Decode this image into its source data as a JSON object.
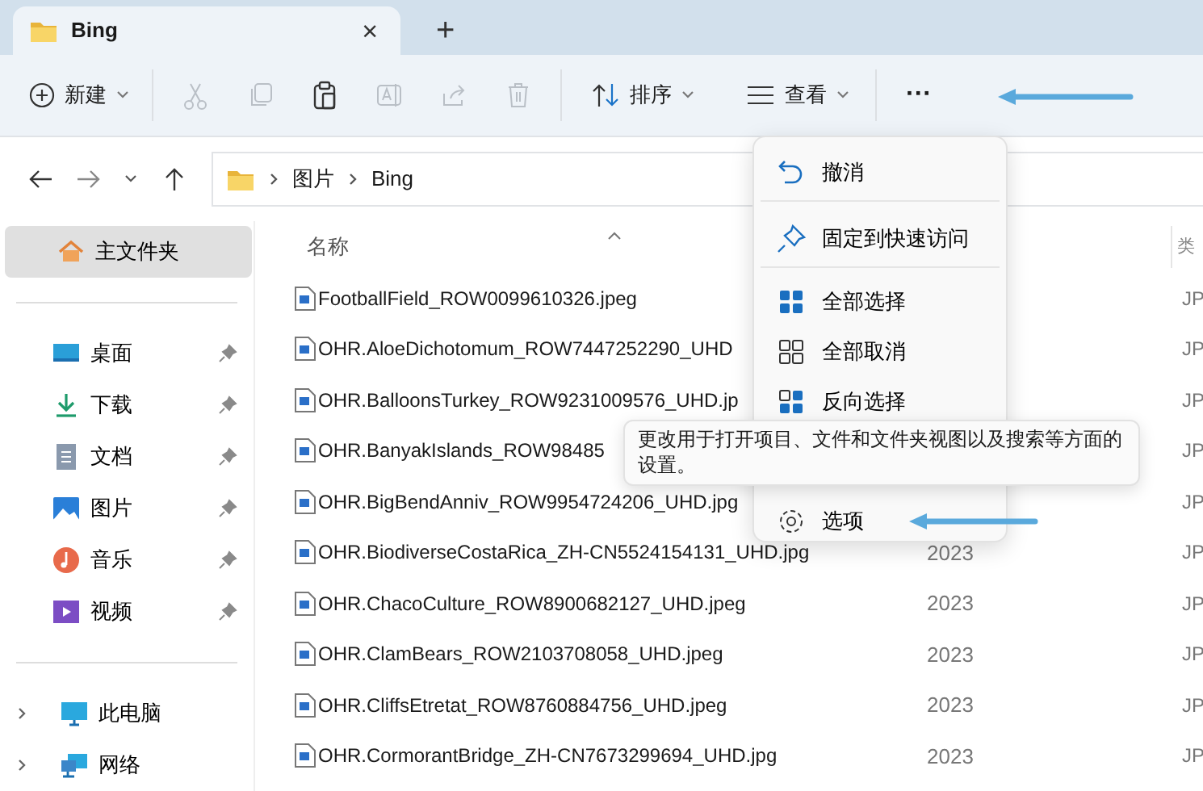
{
  "tab": {
    "title": "Bing",
    "close": "×"
  },
  "new_tab": "+",
  "toolbar": {
    "new": "新建",
    "actions": [
      {
        "kind": "cut",
        "disabled": true
      },
      {
        "kind": "copy",
        "disabled": true
      },
      {
        "kind": "paste",
        "disabled": false
      },
      {
        "kind": "rename",
        "disabled": true
      },
      {
        "kind": "share",
        "disabled": true
      },
      {
        "kind": "delete",
        "disabled": true
      }
    ],
    "sort": "排序",
    "view": "查看",
    "more": "···"
  },
  "breadcrumb": [
    "图片",
    "Bing"
  ],
  "sidebar": {
    "home": {
      "label": "主文件夹",
      "selected": true
    },
    "pinned": [
      {
        "label": "桌面",
        "kind": "desktop",
        "selected": false
      },
      {
        "label": "下载",
        "kind": "download",
        "selected": false
      },
      {
        "label": "文档",
        "kind": "document",
        "selected": false
      },
      {
        "label": "图片",
        "kind": "pictures",
        "selected": false
      },
      {
        "label": "音乐",
        "kind": "music",
        "selected": false
      },
      {
        "label": "视频",
        "kind": "video",
        "selected": false
      }
    ],
    "locations": [
      {
        "label": "此电脑",
        "kind": "pc",
        "selected": false
      },
      {
        "label": "网络",
        "kind": "network",
        "selected": false
      }
    ]
  },
  "table": {
    "columns": [
      "名称",
      "类"
    ],
    "rows": [
      {
        "name": "FootballField_ROW0099610326.jpeg",
        "type": "JP"
      },
      {
        "name": "OHR.AloeDichotomum_ROW7447252290_UHD",
        "type": "JP"
      },
      {
        "name": "OHR.BalloonsTurkey_ROW9231009576_UHD.jp",
        "type": "JP"
      },
      {
        "name": "OHR.BanyakIslands_ROW98485",
        "type": "JP"
      },
      {
        "name": "OHR.BigBendAnniv_ROW9954724206_UHD.jpg",
        "type": "JP"
      },
      {
        "name": "OHR.BiodiverseCostaRica_ZH-CN5524154131_UHD.jpg",
        "date": "2023",
        "type": "JP"
      },
      {
        "name": "OHR.ChacoCulture_ROW8900682127_UHD.jpeg",
        "date": "2023",
        "type": "JP"
      },
      {
        "name": "OHR.ClamBears_ROW2103708058_UHD.jpeg",
        "date": "2023",
        "type": "JP"
      },
      {
        "name": "OHR.CliffsEtretat_ROW8760884756_UHD.jpeg",
        "date": "2023",
        "type": "JP"
      },
      {
        "name": "OHR.CormorantBridge_ZH-CN7673299694_UHD.jpg",
        "date": "2023",
        "type": "JP"
      }
    ]
  },
  "menu": {
    "items": [
      {
        "label": "撤消",
        "kind": "undo",
        "divider_after": true
      },
      {
        "label": "固定到快速访问",
        "kind": "pin",
        "divider_after": true
      },
      {
        "label": "全部选择",
        "kind": "select-all",
        "divider_after": false
      },
      {
        "label": "全部取消",
        "kind": "select-none",
        "divider_after": false
      },
      {
        "label": "反向选择",
        "kind": "invert",
        "divider_after": false
      },
      {
        "label": "选项",
        "kind": "options",
        "divider_after": false
      }
    ]
  },
  "tooltip": "更改用于打开项目、文件和文件夹视图以及搜索等方面的设置。"
}
